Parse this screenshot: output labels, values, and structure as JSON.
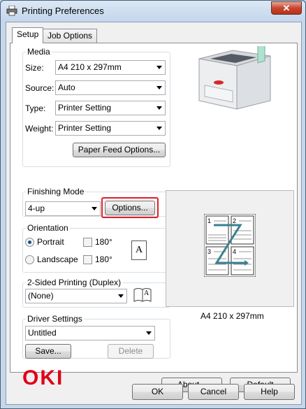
{
  "window": {
    "title": "Printing Preferences",
    "close_glyph": "✕"
  },
  "tabs": [
    {
      "label": "Setup"
    },
    {
      "label": "Job Options"
    }
  ],
  "media": {
    "group_label": "Media",
    "size_label": "Size:",
    "size_value": "A4 210 x 297mm",
    "source_label": "Source:",
    "source_value": "Auto",
    "type_label": "Type:",
    "type_value": "Printer Setting",
    "weight_label": "Weight:",
    "weight_value": "Printer Setting",
    "paper_feed_button": "Paper Feed Options..."
  },
  "finishing": {
    "group_label": "Finishing Mode",
    "value": "4-up",
    "options_button": "Options..."
  },
  "orientation": {
    "group_label": "Orientation",
    "portrait_label": "Portrait",
    "landscape_label": "Landscape",
    "rotate_label_1": "180°",
    "rotate_label_2": "180°",
    "selected": "portrait",
    "page_glyph": "A"
  },
  "duplex": {
    "group_label": "2-Sided Printing (Duplex)",
    "value": "(None)",
    "book_glyph": "A"
  },
  "driver": {
    "group_label": "Driver Settings",
    "value": "Untitled",
    "save_button": "Save...",
    "delete_button": "Delete"
  },
  "preview": {
    "paper_size": "A4 210 x 297mm",
    "page_numbers": [
      "1",
      "2",
      "3",
      "4"
    ]
  },
  "brand": {
    "logo_text": "OKI",
    "logo_color": "#e00016"
  },
  "about_button": "About...",
  "default_button": "Default",
  "dialog": {
    "ok": "OK",
    "cancel": "Cancel",
    "help": "Help"
  }
}
